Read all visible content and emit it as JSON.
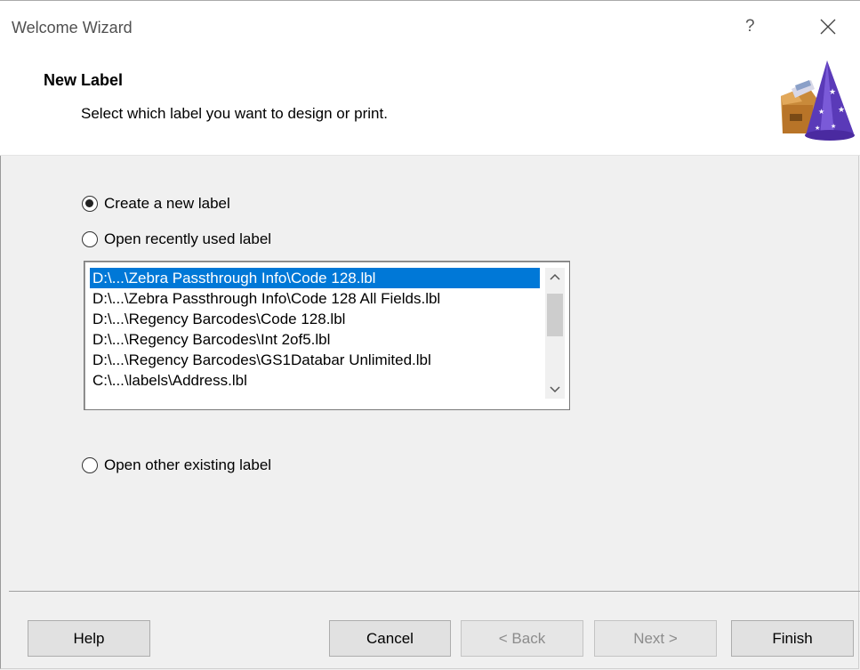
{
  "window": {
    "title": "Welcome Wizard",
    "help_glyph": "?",
    "close_icon": "close-icon"
  },
  "header": {
    "title": "New Label",
    "subtitle": "Select which label you want to design or print.",
    "icon": "wizard-hat-icon"
  },
  "options": {
    "create_new": "Create a new label",
    "open_recent": "Open recently used label",
    "open_other": "Open other existing label",
    "selected": "create_new"
  },
  "recent_files": [
    "D:\\...\\Zebra Passthrough Info\\Code 128.lbl",
    "D:\\...\\Zebra Passthrough Info\\Code 128 All Fields.lbl",
    "D:\\...\\Regency Barcodes\\Code 128.lbl",
    "D:\\...\\Regency Barcodes\\Int 2of5.lbl",
    "D:\\...\\Regency Barcodes\\GS1Databar Unlimited.lbl",
    "C:\\...\\labels\\Address.lbl"
  ],
  "selected_file_index": 0,
  "buttons": {
    "help": "Help",
    "cancel": "Cancel",
    "back": "< Back",
    "next": "Next >",
    "finish": "Finish"
  },
  "colors": {
    "selection": "#0078d7",
    "dialog_bg": "#f0f0f0"
  }
}
